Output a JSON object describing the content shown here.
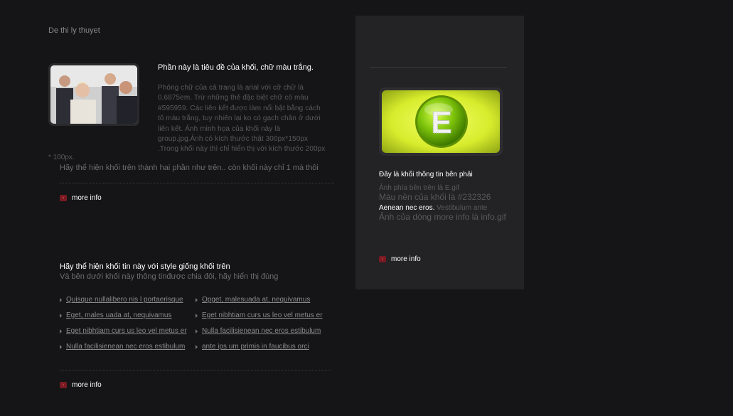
{
  "header": {
    "title": "De thi ly thuyet"
  },
  "block1": {
    "title": "Phần này là tiêu đề của khối, chữ màu trắng.",
    "body_lines": [
      "Phông chữ của cả trang là arial với cỡ chữ là",
      "0.6875em. Trừ những thẻ đặc biệt chữ có màu",
      "#595959. Các liên kết được làm nổi bật bằng cách",
      "tô màu trắng, tuy nhiên lại ko có gạch chân ở dưới",
      "liên kết. Ảnh minh họa của khối này là",
      "group.jpg.Ảnh có kích thước thật 300px*150px",
      ".Trong khối này thì chỉ hiển thị với kích thước 200px"
    ],
    "body_tail": "* 100px.",
    "note": "Hãy thể hiện khối trên thành hai phần như trên.. còn khối này chỉ 1 mà thôi",
    "more_info": "more info"
  },
  "block2": {
    "title": "Hãy thể hiện khối tin này với style giống khối trên",
    "subtitle": "Và bên dưới khối này thông tinđược chia đôi, hãy hiển thị đúng",
    "links": [
      "Quisque nullalibero nis l portaerisque",
      "Opget, malesuada at, nequivamus",
      "Eget, males uada at, nequivamus",
      "Eget nibhtiam curs us leo vel metus er",
      "Eget nibhtiam curs us leo vel metus er",
      "Nulla facilisienean nec eros estibulum",
      "Nulla facilisienean nec eros estibulum",
      "ante ips um primis in faucibus orci"
    ],
    "more_info": "more info"
  },
  "right_panel": {
    "logo_letter": "E",
    "title": "Đây là khối thông tin bên phải",
    "line1": "Ảnh phía bên trên là E.gif",
    "line2": "Màu nền của khối là #232326",
    "line3_bold": "Aenean nec eros.",
    "line3_rest": " Vestibulum ante",
    "line4": "Ảnh của dòng more info là info.gif",
    "more_info": "more info"
  },
  "colors": {
    "background": "#151517",
    "panel": "#232326",
    "text_gray": "#595959",
    "logo_green": "#c4e02a",
    "more_icon": "#7a1a22"
  }
}
